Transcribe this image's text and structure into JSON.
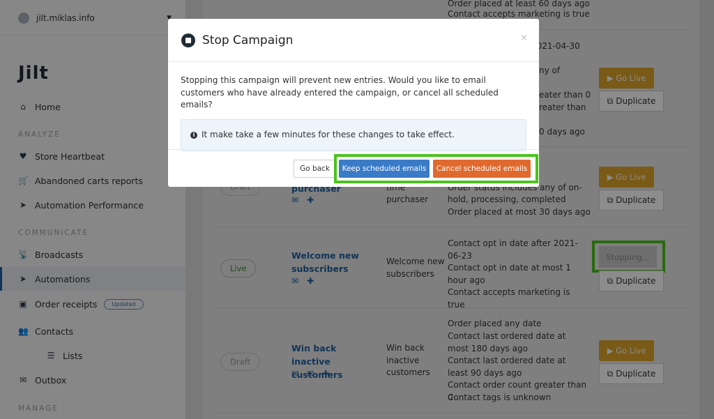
{
  "account": {
    "name": "jilt.miklas.info"
  },
  "logo": "Jilt",
  "sidebar": {
    "home": "Home",
    "analyze": "ANALYZE",
    "store_heartbeat": "Store Heartbeat",
    "abandoned": "Abandoned carts reports",
    "automation_perf": "Automation Performance",
    "communicate": "COMMUNICATE",
    "broadcasts": "Broadcasts",
    "automations": "Automations",
    "order_receipts": "Order receipts",
    "updated_badge": "Updated",
    "contacts": "Contacts",
    "lists": "Lists",
    "outbox": "Outbox",
    "manage": "MANAGE"
  },
  "rows": [
    {
      "conditions_visible": [
        "Order placed at least 60 days ago",
        "Contact accepts marketing is true"
      ]
    },
    {
      "conditions_visible": [
        "2021-04-30",
        "ny of",
        "eater than 0",
        "reater than",
        "0 days ago"
      ],
      "go_live": "Go Live",
      "duplicate": "Duplicate"
    },
    {
      "status": "Draft",
      "name": "purchaser",
      "description": [
        "time",
        "purchaser"
      ],
      "conditions_visible": [
        "Order status includes any of on-",
        "hold, processing, completed",
        "Order placed at most 30 days ago"
      ],
      "go_live": "Go Live",
      "duplicate": "Duplicate"
    },
    {
      "status": "Live",
      "name": "Welcome new subscribers",
      "description": "Welcome new subscribers",
      "conditions": [
        "Contact opt in date after 2021-06-23",
        "Contact opt in date at most 1 hour ago",
        "Contact accepts marketing is true"
      ],
      "action": "Stopping...",
      "duplicate": "Duplicate"
    },
    {
      "status": "Draft",
      "name": "Win back inactive customers",
      "description": "Win back inactive customers",
      "conditions": [
        "Order placed any date",
        "Contact last ordered date at most 180 days ago",
        "Contact last ordered date at least 90 days ago",
        "Contact order count greater than 0",
        "Contact tags is unknown"
      ],
      "go_live": "Go Live",
      "duplicate": "Duplicate"
    }
  ],
  "modal": {
    "title": "Stop Campaign",
    "close": "×",
    "body": "Stopping this campaign will prevent new entries. Would you like to email customers who have already entered the campaign, or cancel all scheduled emails?",
    "info": "It make take a few minutes for these changes to take effect.",
    "go_back": "Go back",
    "keep": "Keep scheduled emails",
    "cancel": "Cancel scheduled emails"
  },
  "colors": {
    "keep": "#3a7bc8",
    "cancel": "#e06a2e",
    "highlight": "#4cc21e",
    "go_live": "#dca42a"
  }
}
